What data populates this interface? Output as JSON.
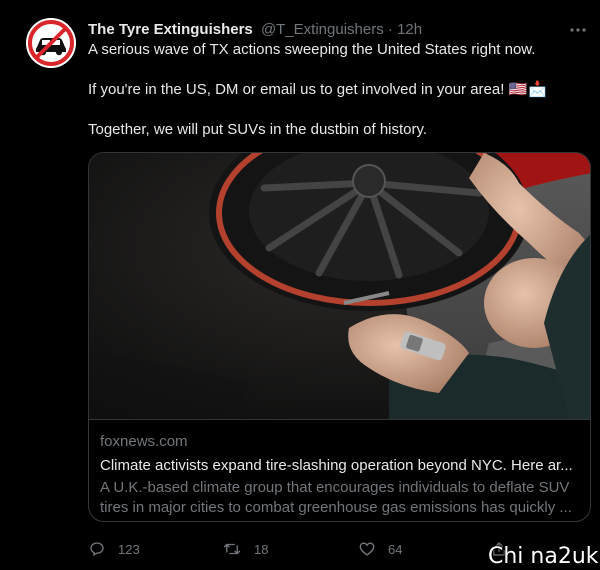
{
  "tweet": {
    "author_name": "The Tyre Extinguishers",
    "handle": "@T_Extinguishers",
    "separator": "·",
    "timestamp": "12h",
    "line1": "A serious wave of TX actions sweeping the United States right now.",
    "line2": "If you're in the US, DM or email us to get involved in your area!",
    "line2_emojis": "🇺🇸📩",
    "line3": "Together, we will put SUVs in the dustbin of history."
  },
  "card": {
    "domain": "foxnews.com",
    "title": "Climate activists expand tire-slashing operation beyond NYC. Here ar...",
    "description": "A U.K.-based climate group that encourages individuals to deflate SUV tires in major cities to combat greenhouse gas emissions has quickly ...",
    "image_alt_icon": "deflating-tire-photo"
  },
  "actions": {
    "replies": "123",
    "retweets": "18",
    "likes": "64"
  },
  "watermark": {
    "text": "Chi na2uk"
  },
  "colors": {
    "background": "#000000",
    "primary_text": "#e7e9ea",
    "secondary_text": "#71767b",
    "border": "#333639",
    "avatar_ring": "#d8262b"
  }
}
